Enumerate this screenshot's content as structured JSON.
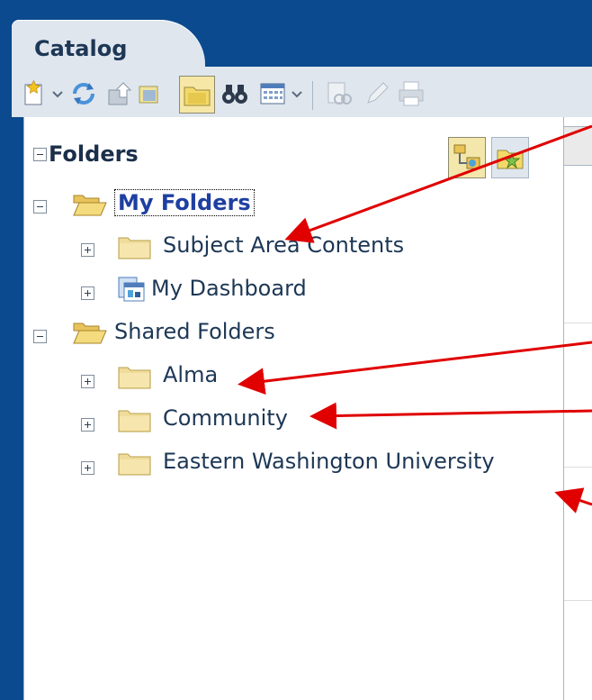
{
  "tab": {
    "label": "Catalog"
  },
  "toolbar": {
    "items": [
      "new-icon",
      "caret-down-icon",
      "refresh-icon",
      "upload-icon",
      "folder-view-icon",
      "folder-toggle-icon",
      "search-icon",
      "calendar-icon",
      "caret-down-icon",
      "properties-icon",
      "edit-icon",
      "print-icon"
    ]
  },
  "panel": {
    "title": "Folders",
    "tree": [
      {
        "label": "My Folders",
        "expanded": true,
        "selected": true,
        "level": 0
      },
      {
        "label": "Subject Area Contents",
        "expanded": false,
        "level": 1
      },
      {
        "label": "My Dashboard",
        "expanded": false,
        "level": 1,
        "icon": "dashboard-icon"
      },
      {
        "label": "Shared Folders",
        "expanded": true,
        "level": 0
      },
      {
        "label": "Alma",
        "expanded": false,
        "level": 1
      },
      {
        "label": "Community",
        "expanded": false,
        "level": 1
      },
      {
        "label": "Eastern Washington University",
        "expanded": false,
        "level": 1
      }
    ]
  },
  "colors": {
    "frame": "#0b4a8e",
    "header": "#dfe6ee",
    "selected_text": "#1e3fa1",
    "annotation_arrow": "#e00000"
  }
}
